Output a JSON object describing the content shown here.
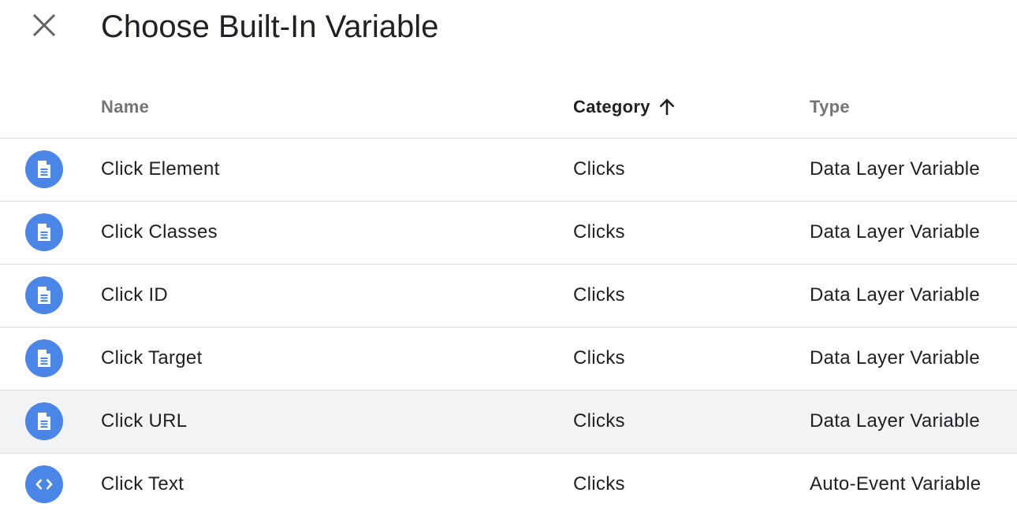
{
  "dialog": {
    "title": "Choose Built-In Variable",
    "close_icon": "close-icon"
  },
  "table": {
    "headers": {
      "name": "Name",
      "category": "Category",
      "type": "Type"
    },
    "sort": {
      "column": "category",
      "direction": "ascending",
      "icon": "arrow-up-icon"
    },
    "rows": [
      {
        "icon": "document-icon",
        "name": "Click Element",
        "category": "Clicks",
        "type": "Data Layer Variable"
      },
      {
        "icon": "document-icon",
        "name": "Click Classes",
        "category": "Clicks",
        "type": "Data Layer Variable"
      },
      {
        "icon": "document-icon",
        "name": "Click ID",
        "category": "Clicks",
        "type": "Data Layer Variable"
      },
      {
        "icon": "document-icon",
        "name": "Click Target",
        "category": "Clicks",
        "type": "Data Layer Variable"
      },
      {
        "icon": "document-icon",
        "name": "Click URL",
        "category": "Clicks",
        "type": "Data Layer Variable"
      },
      {
        "icon": "code-icon",
        "name": "Click Text",
        "category": "Clicks",
        "type": "Auto-Event Variable"
      }
    ]
  },
  "colors": {
    "icon_background": "#4a85e8",
    "hover_row": "#f1f3f4",
    "divider": "#dadce0",
    "header_text": "#757575"
  }
}
